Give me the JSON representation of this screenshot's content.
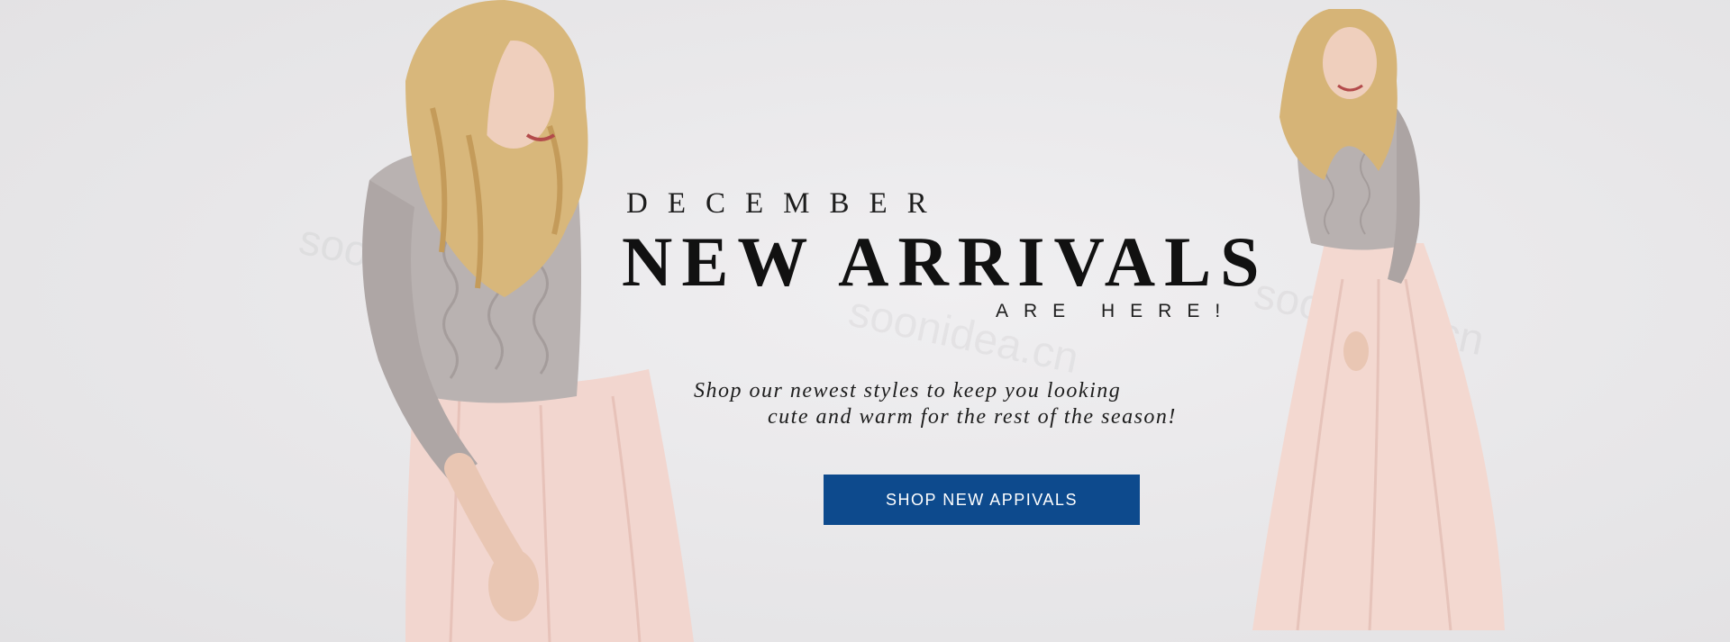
{
  "banner": {
    "pre_title": "DECEMBER",
    "title": "NEW ARRIVALS",
    "sub_title": "ARE HERE!",
    "tagline_line1": "Shop our newest styles to keep you looking",
    "tagline_line2": "cute and warm for the rest of the season!",
    "cta_label": "SHOP NEW APPIVALS",
    "watermark": "soonidea.cn"
  },
  "colors": {
    "background": "#e9e8ea",
    "cta_background": "#0d4a8d",
    "cta_text": "#ffffff",
    "title_text": "#111111"
  },
  "images": {
    "left": "model-left-image",
    "right": "model-right-image"
  }
}
